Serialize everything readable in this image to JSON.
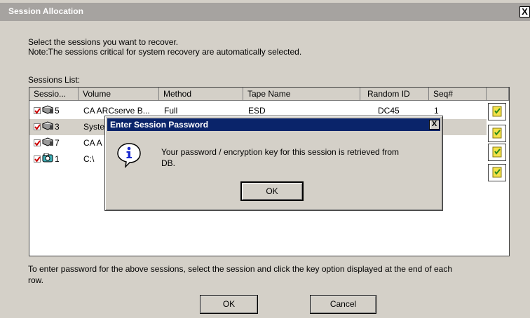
{
  "window": {
    "title": "Session Allocation",
    "close_glyph": "X"
  },
  "instructions": {
    "line1": "Select the sessions you want to recover.",
    "line2": "Note:The sessions critical for system recovery are automatically selected."
  },
  "sessions": {
    "label": "Sessions List:",
    "columns": [
      "Sessio...",
      "Volume",
      "Method",
      "Tape Name",
      "Random ID",
      "Seq#"
    ],
    "rows": [
      {
        "session": "5",
        "volume": "CA ARCserve B...",
        "method": "Full",
        "tape": "ESD",
        "random_id": "DC45",
        "seq": "1",
        "checked": true,
        "icon": "tape-icon",
        "selected": false
      },
      {
        "session": "3",
        "volume": "System State",
        "method": "",
        "tape": "",
        "random_id": "",
        "seq": "",
        "checked": true,
        "icon": "tape-icon",
        "selected": true
      },
      {
        "session": "7",
        "volume": "CA A",
        "method": "",
        "tape": "",
        "random_id": "",
        "seq": "",
        "checked": true,
        "icon": "tape-icon",
        "selected": false
      },
      {
        "session": "1",
        "volume": "C:\\",
        "method": "",
        "tape": "",
        "random_id": "",
        "seq": "",
        "checked": true,
        "icon": "drive-icon",
        "selected": false
      }
    ],
    "key_icon": "key-icon"
  },
  "footer": {
    "hint_line1": "To enter password for the above sessions, select the session and click the key option displayed at the end of each",
    "hint_line2": "row.",
    "ok_label": "OK",
    "cancel_label": "Cancel"
  },
  "dialog": {
    "title": "Enter Session Password",
    "close_glyph": "X",
    "message_line1": "Your password / encryption key for this session is retrieved from",
    "message_line2": "DB.",
    "ok_label": "OK",
    "icon": "info-icon"
  },
  "colors": {
    "dialog_title_bg": "#0a246a",
    "window_title_bg": "#a6a3a0",
    "check_mark": "#cc0000"
  }
}
